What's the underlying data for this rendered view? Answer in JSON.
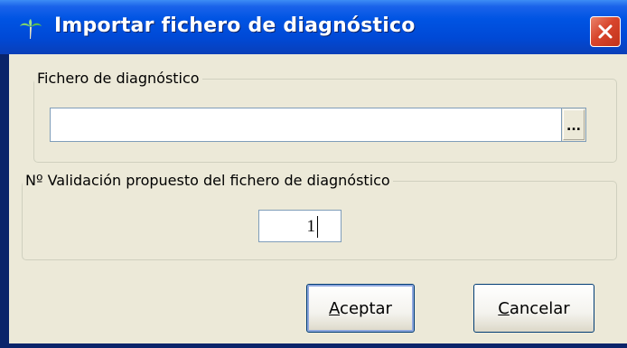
{
  "window": {
    "title": "Importar fichero de diagnóstico",
    "close_icon": "close-icon",
    "app_icon": "palm-tree-icon"
  },
  "file_group": {
    "legend": "Fichero de diagnóstico",
    "file_value": "",
    "browse_label": "..."
  },
  "validation_group": {
    "legend": "Nº Validación propuesto del fichero de diagnóstico",
    "value": "1"
  },
  "buttons": {
    "accept": {
      "mnemonic": "A",
      "rest": "ceptar"
    },
    "cancel": {
      "mnemonic": "C",
      "rest": "ancelar"
    }
  },
  "colors": {
    "titlebar": "#0054e3",
    "dialog_bg": "#ece9d8",
    "close_button": "#d8452c"
  }
}
